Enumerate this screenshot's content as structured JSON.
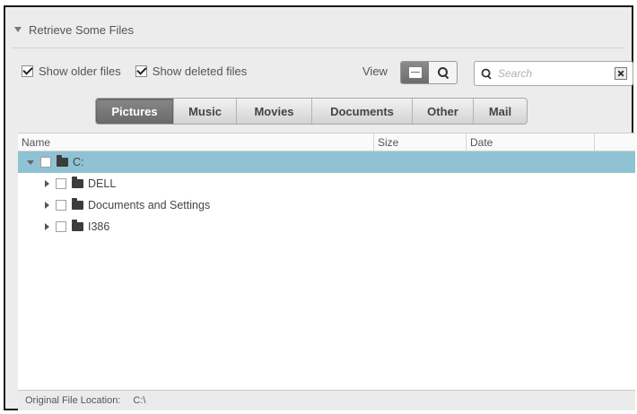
{
  "header": {
    "title": "Retrieve Some Files"
  },
  "options": {
    "show_older": {
      "label": "Show older files",
      "checked": true
    },
    "show_deleted": {
      "label": "Show deleted files",
      "checked": true
    }
  },
  "view": {
    "label": "View",
    "active_mode": "list"
  },
  "search": {
    "placeholder": "Search",
    "value": ""
  },
  "tabs": [
    {
      "label": "Pictures",
      "active": true
    },
    {
      "label": "Music",
      "active": false
    },
    {
      "label": "Movies",
      "active": false
    },
    {
      "label": "Documents",
      "active": false
    },
    {
      "label": "Other",
      "active": false
    },
    {
      "label": "Mail",
      "active": false
    }
  ],
  "table": {
    "columns": [
      "Name",
      "Size",
      "Date"
    ],
    "rows": [
      {
        "name": "C:",
        "level": 0,
        "expanded": true,
        "selected": true
      },
      {
        "name": "DELL",
        "level": 1,
        "expanded": false,
        "selected": false
      },
      {
        "name": "Documents and Settings",
        "level": 1,
        "expanded": false,
        "selected": false
      },
      {
        "name": "I386",
        "level": 1,
        "expanded": false,
        "selected": false
      }
    ]
  },
  "status": {
    "label": "Original File Location:",
    "value": "C:\\"
  },
  "colors": {
    "selection": "#8fc2d2",
    "active_tab": "#7a7a7a"
  }
}
